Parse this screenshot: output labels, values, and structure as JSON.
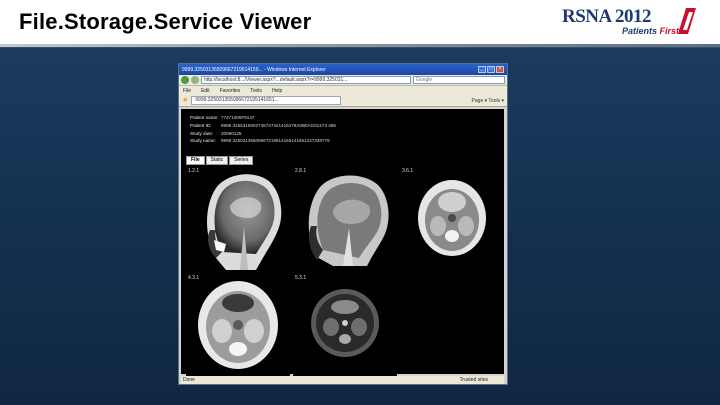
{
  "slide": {
    "title": "File.Storage.Service Viewer"
  },
  "logo": {
    "name": "RSNA",
    "year": "2012",
    "tagline_part1": "Patients ",
    "tagline_part2": "First",
    "brand_color": "#1e3b6e",
    "accent_color": "#c8102e"
  },
  "browser": {
    "window_title": "9999.32503135509667219514159... - Windows Internet Explorer",
    "address": "http://localhost:8.../Viewer.aspx?...default.aspx?r=9999.325031...",
    "search_placeholder": "Google",
    "menu": [
      "File",
      "Edit",
      "Favorites",
      "Tools",
      "Help"
    ],
    "page_tab": "9999.325031355096672195141651...",
    "tools_text": "Page ▾  Tools ▾",
    "status_left": "Done",
    "status_zone": "Trusted sites"
  },
  "viewer": {
    "fields": [
      {
        "key": "Patient name:",
        "value": "77471009F9147"
      },
      {
        "key": "Patient ID:",
        "value": "9999.3255315502745747421415278A0B0AG01273 485"
      },
      {
        "key": "Study date:",
        "value": "20090125"
      },
      {
        "key": "Study name:",
        "value": "9999.32503135509667219514165141651237338779"
      }
    ],
    "tabs": [
      {
        "label": "File",
        "active": true
      },
      {
        "label": "Static",
        "active": false
      },
      {
        "label": "Series",
        "active": false
      }
    ],
    "series": [
      {
        "label": "1.2.1",
        "view": "sagittal"
      },
      {
        "label": "2.8.1",
        "view": "sagittal"
      },
      {
        "label": "3.6.1",
        "view": "axial"
      },
      {
        "label": "4.3.1",
        "view": "axial"
      },
      {
        "label": "5.3.1",
        "view": "axial-dark"
      }
    ]
  }
}
